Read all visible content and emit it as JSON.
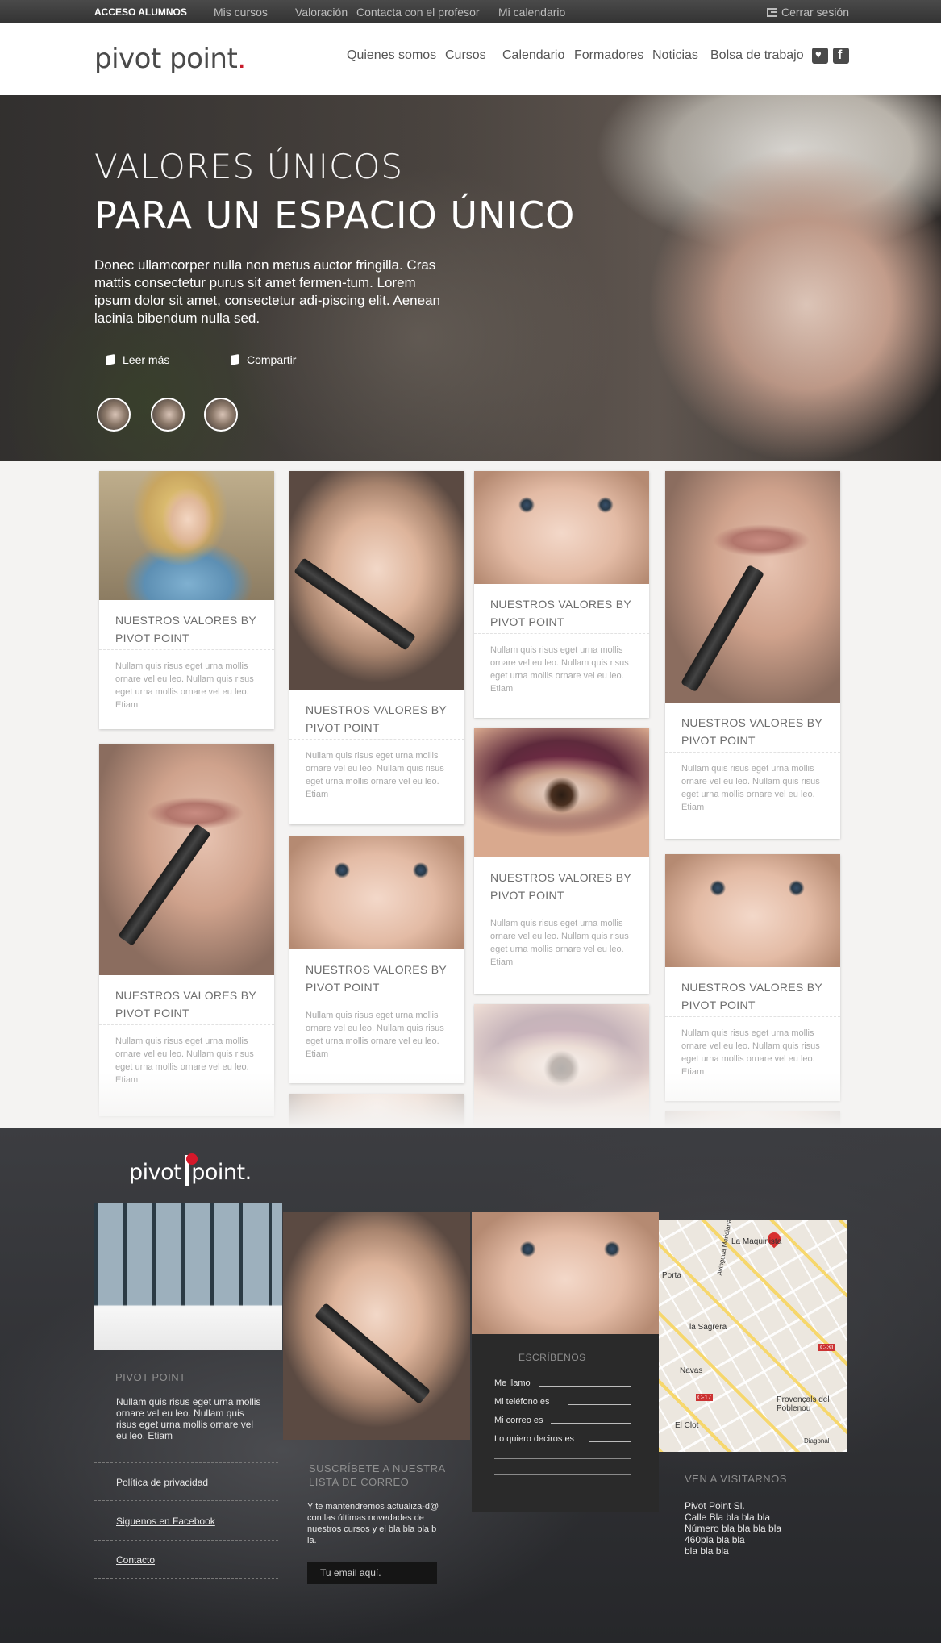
{
  "topbar": {
    "access_label": "ACCESO ALUMNOS",
    "links": [
      "Mis cursos",
      "Valoración",
      "Contacta con el profesor",
      "Mi calendario"
    ],
    "logout_label": "Cerrar sesión"
  },
  "header": {
    "logo_text": "pivot point",
    "logo_dot": ".",
    "nav": [
      "Quienes somos",
      "Cursos",
      "Calendario",
      "Formadores",
      "Noticias",
      "Bolsa de trabajo"
    ]
  },
  "hero": {
    "title_line1": "VALORES ÚNICOS",
    "title_line2": "PARA UN ESPACIO ÚNICO",
    "lead": "Donec ullamcorper nulla non metus auctor fringilla. Cras mattis consectetur purus sit amet fermen-tum. Lorem ipsum dolor sit amet, consectetur adi-piscing elit. Aenean lacinia bibendum nulla sed.",
    "read_more": "Leer más",
    "share": "Compartir"
  },
  "card": {
    "title": "NUESTROS VALORES BY PIVOT POINT",
    "body": "Nullam quis risus eget urna mollis ornare vel eu leo. Nullam quis risus eget urna mollis ornare vel eu leo. Etiam"
  },
  "footer": {
    "logo_left": "pivot",
    "logo_right": "point.",
    "about_title": "PIVOT POINT",
    "about_text": "Nullam quis risus eget urna mollis ornare vel eu leo. Nullam quis risus eget urna mollis ornare vel eu leo. Etiam",
    "links": [
      "Política de privacidad",
      "Siguenos en Facebook",
      "Contacto"
    ],
    "newsletter_title": "SUSCRÍBETE A NUESTRA LISTA DE CORREO",
    "newsletter_text": "Y te mantendremos actualiza-d@ con las últimas novedades de nuestros cursos y el bla bla bla b la.",
    "email_placeholder": "Tu email aquí.",
    "form_title": "ESCRÍBENOS",
    "form_fields": [
      "Me llamo",
      "Mi teléfono es",
      "Mi correo es",
      "Lo quiero deciros es"
    ],
    "visit_title": "VEN A VISITARNOS",
    "address": [
      "Pivot Point Sl.",
      "Calle Bla bla bla bla",
      "Número bla bla bla bla",
      "460bla bla bla",
      "bla bla bla"
    ],
    "map_labels": [
      "La Maquinista",
      "Porta",
      "la Sagrera",
      "Navas",
      "El Clot",
      "Provençals del Poblenou",
      "C-31",
      "C-17",
      "Avinguda Meridiana",
      "Diagonal"
    ]
  },
  "colors": {
    "accent": "#c81b2a",
    "topbar": "#3a3a3a",
    "footer": "#2e2f33"
  }
}
